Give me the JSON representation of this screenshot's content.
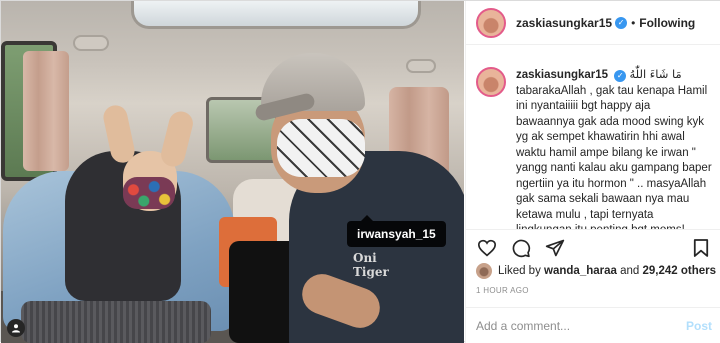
{
  "post": {
    "tagged_user": "irwansyah_15",
    "logo_text": "Oni\nTiger"
  },
  "header": {
    "username": "zaskiasungkar15",
    "separator": "•",
    "follow_label": "Following"
  },
  "caption": {
    "username": "zaskiasungkar15",
    "arabic": "مَا شَاءَ اللّٰهُ",
    "text": "tabarakaAllah , gak tau kenapa Hamil ini nyantaiiiii bgt happy aja bawaannya gak ada mood swing kyk yg ak sempet khawatirin hhi awal waktu hamil ampe bilang ke irwan \" yangg nanti kalau aku gampang baper ngertiin ya itu hormon \" .. masyaAllah gak sama sekali bawaan nya mau ketawa mulu , tapi ternyata lingkungan itu penting bgt moms!"
  },
  "likes": {
    "prefix": "Liked by",
    "user": "wanda_haraa",
    "conj": "and",
    "others": "29,242 others"
  },
  "timestamp": "1 HOUR AGO",
  "comment": {
    "placeholder": "Add a comment...",
    "post_label": "Post"
  },
  "icons": {
    "like": "heart-icon",
    "comment": "comment-icon",
    "share": "share-icon",
    "save": "bookmark-icon",
    "verified": "verified-badge-icon",
    "tag": "user-tag-icon"
  },
  "colors": {
    "verified": "#3897f0",
    "post_disabled": "#b2dffc",
    "story_ring": "#e35b8a"
  }
}
